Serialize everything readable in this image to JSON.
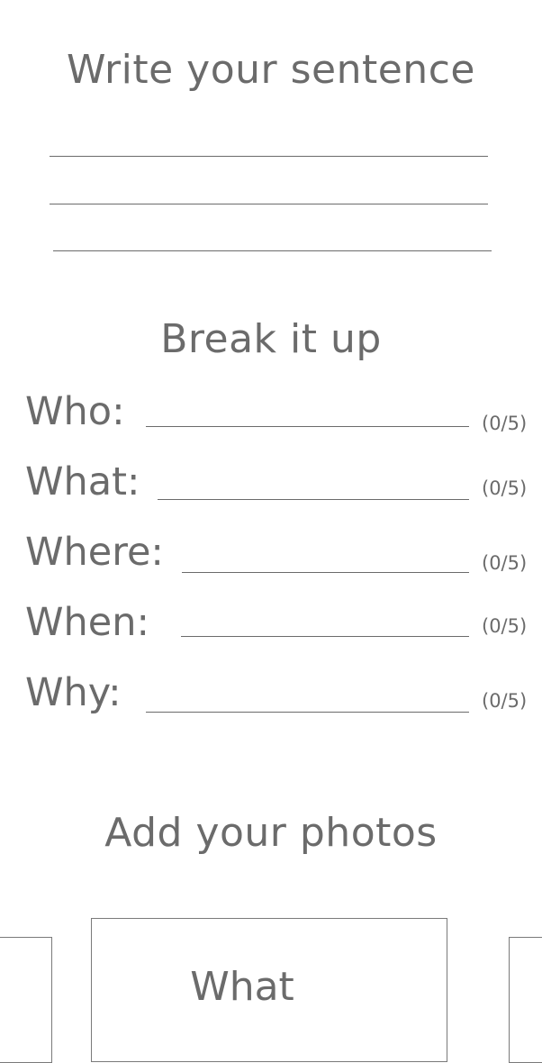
{
  "sentence_section": {
    "title": "Write your sentence"
  },
  "breakdown_section": {
    "title": "Break it up",
    "rows": [
      {
        "label": "Who:",
        "count": "(0/5)"
      },
      {
        "label": "What:",
        "count": "(0/5)"
      },
      {
        "label": "Where:",
        "count": "(0/5)"
      },
      {
        "label": "When:",
        "count": "(0/5)"
      },
      {
        "label": "Why:",
        "count": "(0/5)"
      }
    ]
  },
  "photos_section": {
    "title": "Add your photos",
    "cards": [
      {
        "label": ""
      },
      {
        "label": "What"
      },
      {
        "label": ""
      }
    ]
  }
}
